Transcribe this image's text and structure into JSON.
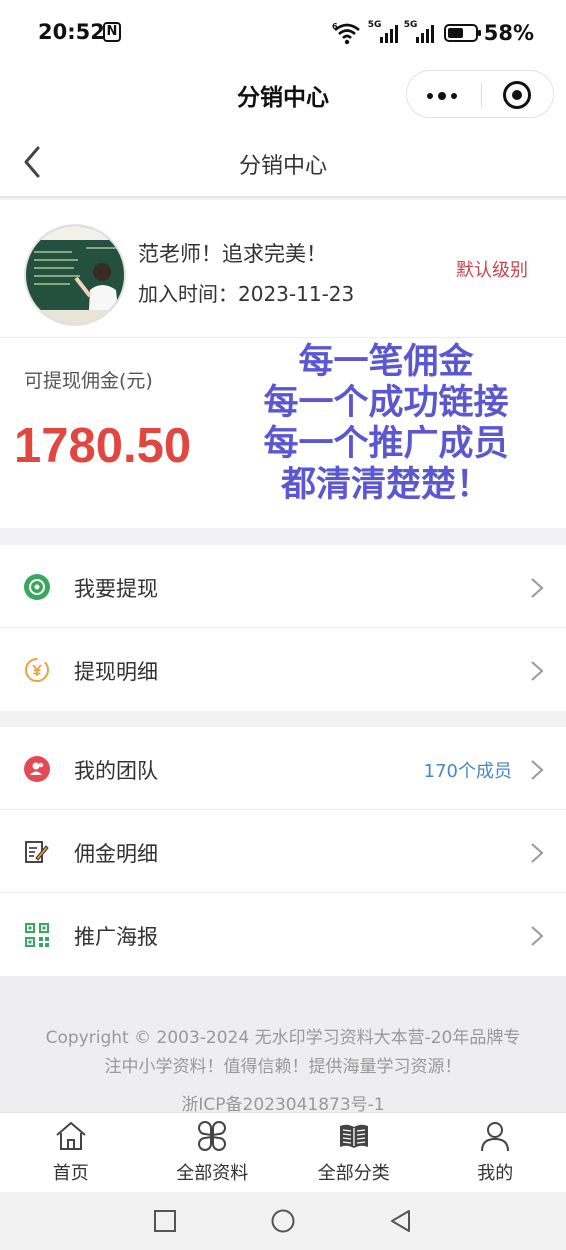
{
  "status_bar": {
    "time": "20:52",
    "nfc": "N",
    "signal_1_tag": "5G",
    "signal_2_tag": "5G",
    "wifi_tag": "6",
    "battery_percent": "58%",
    "battery_level": 0.58
  },
  "mini_program": {
    "title": "分销中心"
  },
  "nav": {
    "title": "分销中心"
  },
  "profile": {
    "name": "范老师！追求完美！",
    "joined": "加入时间：2023-11-23",
    "level": "默认级别"
  },
  "commission": {
    "label": "可提现佣金(元)",
    "amount": "1780.50",
    "promo_lines": [
      "每一笔佣金",
      "每一个成功链接",
      "每一个推广成员",
      "都清清楚楚！"
    ]
  },
  "menu_group_1": [
    {
      "label": "我要提现",
      "icon": "withdraw-icon"
    },
    {
      "label": "提现明细",
      "icon": "yuan-icon"
    }
  ],
  "menu_group_2": [
    {
      "label": "我的团队",
      "icon": "team-icon",
      "extra": "170个成员"
    },
    {
      "label": "佣金明细",
      "icon": "edit-doc-icon"
    },
    {
      "label": "推广海报",
      "icon": "qrcode-icon"
    }
  ],
  "footer": {
    "copyright_line_1": "Copyright © 2003-2024 无水印学习资料大本营-20年品牌专",
    "copyright_line_2": "注中小学资料！值得信赖！提供海量学习资源！",
    "icp": "浙ICP备2023041873号-1"
  },
  "tabbar": [
    {
      "label": "首页",
      "icon": "home-icon"
    },
    {
      "label": "全部资料",
      "icon": "clover-icon"
    },
    {
      "label": "全部分类",
      "icon": "book-icon"
    },
    {
      "label": "我的",
      "icon": "user-icon"
    }
  ],
  "colors": {
    "accent_red": "#e2473f",
    "promo_purple": "#5b57d0",
    "level_red": "#c9444c",
    "link_blue": "#4a86c8",
    "green": "#3aa85c",
    "orange": "#e8a040"
  }
}
